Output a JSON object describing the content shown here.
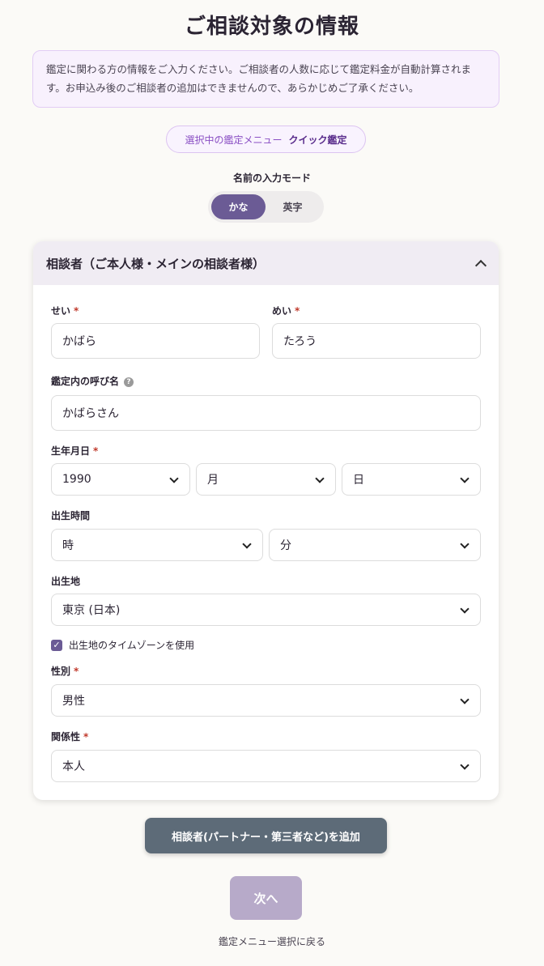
{
  "page_title": "ご相談対象の情報",
  "notice": "鑑定に関わる方の情報をご入力ください。ご相談者の人数に応じて鑑定料金が自動計算されます。お申込み後のご相談者の追加はできませんので、あらかじめご了承ください。",
  "menu_pill": {
    "label": "選択中の鑑定メニュー",
    "value": "クイック鑑定"
  },
  "name_mode": {
    "label": "名前の入力モード",
    "options": [
      "かな",
      "英字"
    ],
    "selected": "かな"
  },
  "card": {
    "title": "相談者（ご本人様・メインの相談者様）",
    "required_mark": "*",
    "help_glyph": "?",
    "last_name": {
      "label": "せい",
      "value": "かばら"
    },
    "first_name": {
      "label": "めい",
      "value": "たろう"
    },
    "nickname": {
      "label": "鑑定内の呼び名",
      "value": "かばらさん"
    },
    "birth_date": {
      "label": "生年月日",
      "year": "1990",
      "month": "月",
      "day": "日"
    },
    "birth_time": {
      "label": "出生時間",
      "hour": "時",
      "minute": "分"
    },
    "birth_place": {
      "label": "出生地",
      "value": "東京 (日本)"
    },
    "timezone_checkbox": {
      "label": "出生地のタイムゾーンを使用",
      "checked": true,
      "check_glyph": "✓"
    },
    "gender": {
      "label": "性別",
      "value": "男性"
    },
    "relationship": {
      "label": "関係性",
      "value": "本人"
    }
  },
  "add_button": "相談者(パートナー・第三者など)を追加",
  "next_button": "次へ",
  "back_link": "鑑定メニュー選択に戻る",
  "colors": {
    "accent": "#6b5b95",
    "secondary_button": "#5d6b78",
    "disabled_button": "#b7aac9",
    "required": "#c0392b"
  }
}
